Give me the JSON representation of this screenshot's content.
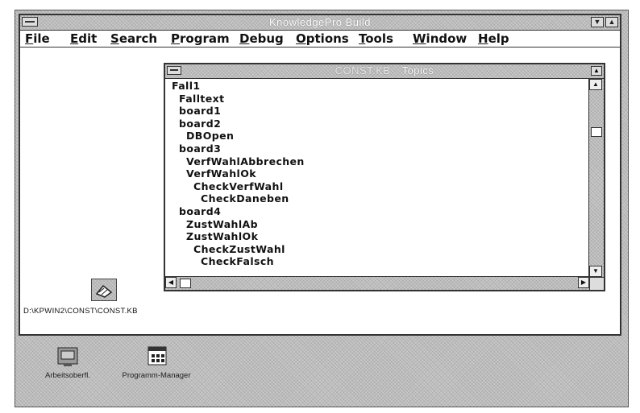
{
  "app": {
    "title": "KnowledgePro Build",
    "minimize_glyph": "▼",
    "maximize_glyph": "▲"
  },
  "menu": [
    {
      "label": "File",
      "u": "F",
      "rest": "ile"
    },
    {
      "label": "Edit",
      "u": "E",
      "rest": "dit"
    },
    {
      "label": "Search",
      "u": "S",
      "rest": "earch"
    },
    {
      "label": "Program",
      "u": "P",
      "rest": "rogram"
    },
    {
      "label": "Debug",
      "u": "D",
      "rest": "ebug"
    },
    {
      "label": "Options",
      "u": "O",
      "rest": "ptions"
    },
    {
      "label": "Tools",
      "u": "T",
      "rest": "ools"
    },
    {
      "label": "Window",
      "u": "W",
      "rest": "indow"
    },
    {
      "label": "Help",
      "u": "H",
      "rest": "elp"
    }
  ],
  "topics_window": {
    "title": "Topics",
    "subtitle": "CONST.KB",
    "items": [
      {
        "label": "Fall1",
        "level": 0
      },
      {
        "label": "Falltext",
        "level": 1
      },
      {
        "label": "board1",
        "level": 1
      },
      {
        "label": "board2",
        "level": 1
      },
      {
        "label": "DBOpen",
        "level": 2
      },
      {
        "label": "board3",
        "level": 1
      },
      {
        "label": "VerfWahlAbbrechen",
        "level": 2
      },
      {
        "label": "VerfWahlOk",
        "level": 2
      },
      {
        "label": "CheckVerfWahl",
        "level": 3
      },
      {
        "label": "CheckDaneben",
        "level": 4
      },
      {
        "label": "board4",
        "level": 1
      },
      {
        "label": "ZustWahlAb",
        "level": 2
      },
      {
        "label": "ZustWahlOk",
        "level": 2
      },
      {
        "label": "CheckZustWahl",
        "level": 3
      },
      {
        "label": "CheckFalsch",
        "level": 4
      }
    ]
  },
  "minimized_window": {
    "path": "D:\\KPWIN2\\CONST\\CONST.KB"
  },
  "desktop_icons": [
    {
      "label": "Arbeitsoberfl.",
      "icon": "workspace-icon"
    },
    {
      "label": "Programm-Manager",
      "icon": "program-manager-icon"
    }
  ]
}
